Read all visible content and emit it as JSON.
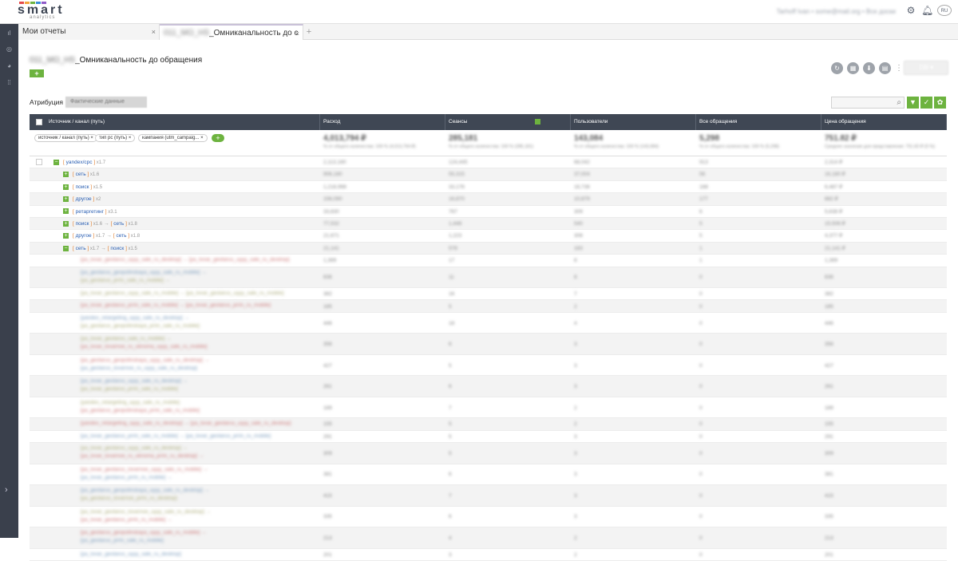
{
  "brand": {
    "logo_text": "smart",
    "logo_sub": "analytics",
    "bar_colors": [
      "#e54b4b",
      "#f4a53b",
      "#6db33f",
      "#3a8fd6",
      "#8e5ac8"
    ]
  },
  "header": {
    "user_text": "Tarhoff Ivan  •  some@mail.org  •  Все доски",
    "icons": [
      "gear-icon",
      "bell-icon",
      "lang-icon"
    ],
    "lang": "RU"
  },
  "sidebar": {
    "items": [
      "chart-icon",
      "layers-icon",
      "pie-icon",
      "grid-icon"
    ],
    "expand": "›"
  },
  "tabs": [
    {
      "label": "Мои отчеты",
      "close": "×"
    },
    {
      "prefix": "011_MO_HS",
      "label": "_Омниканальность до с",
      "close": "×"
    }
  ],
  "tab_add": "+",
  "report": {
    "title_prefix": "011_MO_HS",
    "title": "_Омниканальность до обращения",
    "add_label": "+",
    "round_icons": [
      "refresh-icon",
      "table-icon",
      "download-icon",
      "calendar-icon"
    ],
    "kebab": "⋮",
    "period": "1W ▾"
  },
  "attribution": {
    "label": "Атрибуция",
    "value": "Фактические данные"
  },
  "search_icon": "⌕",
  "toolbar": {
    "filter": "▼",
    "check": "✓",
    "settings": "✿"
  },
  "columns": [
    {
      "label": "Источник / канал (путь)"
    },
    {
      "label": "Расход"
    },
    {
      "label": "Сеансы"
    },
    {
      "label": "Пользователи"
    },
    {
      "label": "Все обращения"
    },
    {
      "label": "Цена обращения"
    }
  ],
  "chips": [
    "источник / канал (путь)",
    "тип рс (путь)",
    "кампания (utm_campaig..."
  ],
  "chip_close": "×",
  "totals": [
    {
      "big": "4,013,794 ₽",
      "small": "% от общего количества: 100 % (4,013,794 ₽)"
    },
    {
      "big": "285,181",
      "small": "% от общего количества: 100 % (285,181)"
    },
    {
      "big": "143,084",
      "small": "% от общего количества: 100 % (143,084)"
    },
    {
      "big": "5,298",
      "small": "% от общего количества: 100 % (5,298)"
    },
    {
      "big": "751.82 ₽",
      "small": "Среднее значение для представления: 751.82 ₽ (0 %)"
    }
  ],
  "tree_rows": [
    {
      "level": 0,
      "sign": "−",
      "path": [
        {
          "ch": "yandex/cpc",
          "m": "x1.7"
        }
      ],
      "vals": [
        "2,113,180",
        "124,445",
        "68,042",
        "913",
        "2,314 ₽"
      ]
    },
    {
      "level": 1,
      "sign": "+",
      "path": [
        {
          "ch": "сеть",
          "m": "x1.6"
        }
      ],
      "vals": [
        "906,180",
        "55,315",
        "37,004",
        "56",
        "16,180 ₽"
      ]
    },
    {
      "level": 1,
      "sign": "+",
      "path": [
        {
          "ch": "поиск",
          "m": "x1.5"
        }
      ],
      "vals": [
        "1,218,998",
        "33,176",
        "16,736",
        "188",
        "6,487 ₽"
      ]
    },
    {
      "level": 1,
      "sign": "+",
      "path": [
        {
          "ch": "другое",
          "m": "x2"
        }
      ],
      "vals": [
        "156,090",
        "16,870",
        "10,879",
        "177",
        "882 ₽"
      ]
    },
    {
      "level": 1,
      "sign": "+",
      "path": [
        {
          "ch": "ретаргетинг",
          "m": "x3.1"
        }
      ],
      "vals": [
        "33,830",
        "767",
        "309",
        "6",
        "5,638 ₽"
      ]
    },
    {
      "level": 1,
      "sign": "+",
      "path": [
        {
          "ch": "поиск",
          "m": "x1.6"
        },
        {
          "ch": "сеть",
          "m": "x1.8"
        }
      ],
      "vals": [
        "77,532",
        "1,448",
        "540",
        "5",
        "15,506 ₽"
      ]
    },
    {
      "level": 1,
      "sign": "+",
      "path": [
        {
          "ch": "другое",
          "m": "x1.7"
        },
        {
          "ch": "сеть",
          "m": "x1.8"
        }
      ],
      "vals": [
        "21,671",
        "1,223",
        "308",
        "5",
        "4,377 ₽"
      ]
    },
    {
      "level": 1,
      "sign": "−",
      "path": [
        {
          "ch": "сеть",
          "m": "x1.7"
        },
        {
          "ch": "поиск",
          "m": "x1.5"
        }
      ],
      "vals": [
        "21,141",
        "578",
        "183",
        "1",
        "21,141 ₽"
      ]
    }
  ],
  "detail_rows": [
    {
      "lines": [
        "[ya_tovar_geotarus_uyyy_sale_ru_desktop]  →  [ya_tovar_geotarus_uyyy_sale_ru_desktop]"
      ],
      "vals": [
        "1,389",
        "17",
        "8",
        "1",
        "1,389"
      ]
    },
    {
      "lines": [
        "[ya_geotarus_geopolinskaya_uyyy_sale_ru_mobile]  →",
        "[ya_geotarus_prrin_sale_ru_mobile]  →"
      ],
      "vals": [
        "836",
        "11",
        "8",
        "0",
        "836"
      ]
    },
    {
      "lines": [
        "[ya_tovar_geotarus_uyyy_sale_ru_mobile]  →  [ya_tovar_geotarus_uyyy_sale_ru_mobile]"
      ],
      "vals": [
        "382",
        "16",
        "7",
        "0",
        "382"
      ]
    },
    {
      "lines": [
        "[ya_tovar_geotarus_prrin_sale_ru_mobile]  →  [ya_tovar_geotarus_prrin_ru_mobile]"
      ],
      "vals": [
        "185",
        "5",
        "2",
        "0",
        "185"
      ]
    },
    {
      "lines": [
        "[yandex_retargeting_uyyy_sale_ru_desktop]  →",
        "[ya_geotarus_geopolinskaya_prrin_sale_ru_mobile]"
      ],
      "vals": [
        "446",
        "18",
        "4",
        "0",
        "446"
      ]
    },
    {
      "lines": [
        "[ya_tovar_geotarus_sale_ru_mobile]  →",
        "[ya_tovar_tovarnoe_ru_uknoma_uyyy_sale_ru_mobile]"
      ],
      "vals": [
        "356",
        "6",
        "3",
        "0",
        "356"
      ]
    },
    {
      "lines": [
        "[ya_geotarus_geopolinskaya_uyyy_sale_ru_desktop]  →",
        "[ya_geotarus_tovarnoe_ru_uyyy_sale_ru_desktop]"
      ],
      "vals": [
        "427",
        "5",
        "3",
        "0",
        "427"
      ]
    },
    {
      "lines": [
        "[ya_tovar_geotarus_uyyy_sale_ru_desktop]  →",
        "[ya_tovar_geotarus_prrin_sale_ru_mobile]"
      ],
      "vals": [
        "261",
        "6",
        "3",
        "0",
        "261"
      ]
    },
    {
      "lines": [
        "[yandex_retargeting_uyyy_sale_ru_mobile]",
        "[ya_geotarus_geopolinskaya_prrin_sale_ru_mobile]"
      ],
      "vals": [
        "189",
        "7",
        "2",
        "0",
        "189"
      ]
    },
    {
      "lines": [
        "[yandex_retargeting_uyyy_sale_ru_desktop]  →  [ya_tovar_geotarus_uyyy_sale_ru_desktop]"
      ],
      "vals": [
        "155",
        "5",
        "2",
        "0",
        "155"
      ]
    },
    {
      "lines": [
        "[ya_tovar_geotarus_prrin_sale_ru_mobile]  →  [ya_tovar_geotarus_prrin_ru_mobile]"
      ],
      "vals": [
        "291",
        "5",
        "3",
        "0",
        "291"
      ]
    },
    {
      "lines": [
        "[ya_tovar_geotarus_uyyy_sale_ru_desktop]  →",
        "[ya_tovar_tovarnoe_ru_uknoma_prrin_ru_desktop]  →"
      ],
      "vals": [
        "309",
        "5",
        "3",
        "0",
        "309"
      ]
    },
    {
      "lines": [
        "[ya_tovar_geotarus_tovarnoe_uyyy_sale_ru_mobile]  →",
        "[ya_tovar_geotarus_prrin_ru_mobile]  →"
      ],
      "vals": [
        "381",
        "6",
        "3",
        "0",
        "381"
      ]
    },
    {
      "lines": [
        "[ya_geotarus_geopolinskaya_uyyy_sale_ru_desktop]  →",
        "[ya_geotarus_tovarnoe_prrin_ru_desktop]"
      ],
      "vals": [
        "415",
        "7",
        "3",
        "0",
        "415"
      ]
    },
    {
      "lines": [
        "[ya_tovar_geotarus_tovarnoe_uyyy_sale_ru_desktop]  →",
        "[ya_tovar_geotarus_prrin_ru_mobile]  →"
      ],
      "vals": [
        "335",
        "6",
        "3",
        "0",
        "335"
      ]
    },
    {
      "lines": [
        "[ya_geotarus_geopolinskaya_uyyy_sale_ru_mobile]  →",
        "[ya_geotarus_prrin_sale_ru_mobile]"
      ],
      "vals": [
        "213",
        "4",
        "2",
        "0",
        "213"
      ]
    },
    {
      "lines": [
        "[ya_tovar_geotarus_uyyy_sale_ru_desktop]"
      ],
      "vals": [
        "201",
        "3",
        "2",
        "0",
        "201"
      ]
    }
  ]
}
